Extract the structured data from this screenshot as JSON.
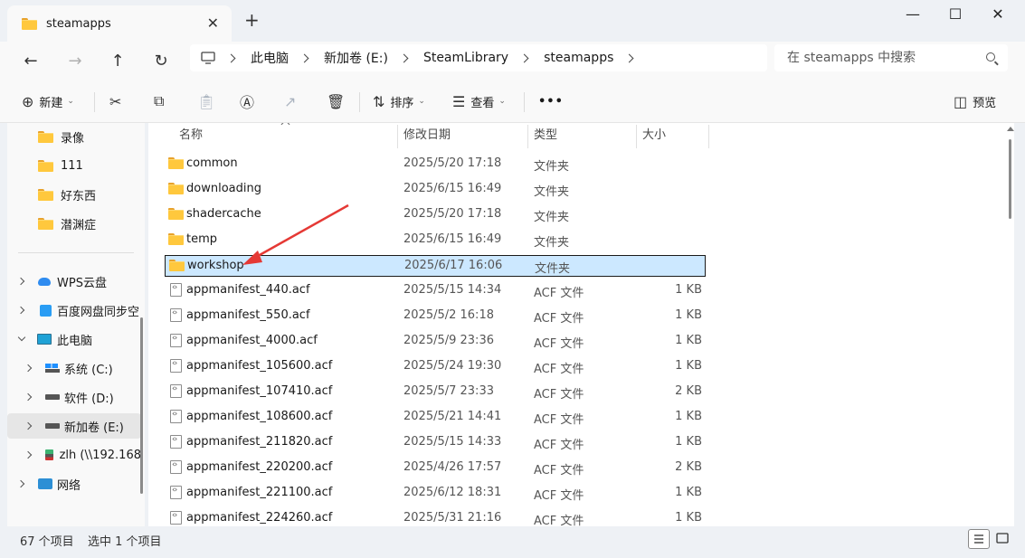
{
  "window": {
    "tab_title": "steamapps",
    "new_tab": "+",
    "close_tab": "✕",
    "minimize": "—",
    "maximize": "☐",
    "close": "✕"
  },
  "nav": {
    "back": "←",
    "forward": "→",
    "up": "↑",
    "refresh": "↻"
  },
  "breadcrumb": [
    "此电脑",
    "新加卷 (E:)",
    "SteamLibrary",
    "steamapps"
  ],
  "search": {
    "placeholder": "在 steamapps 中搜索"
  },
  "commandbar": {
    "new_label": "新建",
    "sort_label": "排序",
    "view_label": "查看",
    "more_label": "•••",
    "preview_label": "预览"
  },
  "sidebar": {
    "quick": [
      "录像",
      "111",
      "好东西",
      "潜渊症"
    ],
    "wps": "WPS云盘",
    "baidu": "百度网盘同步空",
    "thispc": "此电脑",
    "drives": [
      "系统 (C:)",
      "软件 (D:)",
      "新加卷 (E:)",
      "zlh (\\\\192.168"
    ],
    "network": "网络"
  },
  "columns": {
    "name": "名称",
    "date": "修改日期",
    "type": "类型",
    "size": "大小"
  },
  "files": [
    {
      "name": "common",
      "date": "2025/5/20 17:18",
      "type": "文件夹",
      "size": "",
      "kind": "folder"
    },
    {
      "name": "downloading",
      "date": "2025/6/15 16:49",
      "type": "文件夹",
      "size": "",
      "kind": "folder"
    },
    {
      "name": "shadercache",
      "date": "2025/5/20 17:18",
      "type": "文件夹",
      "size": "",
      "kind": "folder"
    },
    {
      "name": "temp",
      "date": "2025/6/15 16:49",
      "type": "文件夹",
      "size": "",
      "kind": "folder"
    },
    {
      "name": "workshop",
      "date": "2025/6/17 16:06",
      "type": "文件夹",
      "size": "",
      "kind": "folder",
      "selected": true
    },
    {
      "name": "appmanifest_440.acf",
      "date": "2025/5/15 14:34",
      "type": "ACF 文件",
      "size": "1 KB",
      "kind": "file"
    },
    {
      "name": "appmanifest_550.acf",
      "date": "2025/5/2 16:18",
      "type": "ACF 文件",
      "size": "1 KB",
      "kind": "file"
    },
    {
      "name": "appmanifest_4000.acf",
      "date": "2025/5/9 23:36",
      "type": "ACF 文件",
      "size": "1 KB",
      "kind": "file"
    },
    {
      "name": "appmanifest_105600.acf",
      "date": "2025/5/24 19:30",
      "type": "ACF 文件",
      "size": "1 KB",
      "kind": "file"
    },
    {
      "name": "appmanifest_107410.acf",
      "date": "2025/5/7 23:33",
      "type": "ACF 文件",
      "size": "2 KB",
      "kind": "file"
    },
    {
      "name": "appmanifest_108600.acf",
      "date": "2025/5/21 14:41",
      "type": "ACF 文件",
      "size": "1 KB",
      "kind": "file"
    },
    {
      "name": "appmanifest_211820.acf",
      "date": "2025/5/15 14:33",
      "type": "ACF 文件",
      "size": "1 KB",
      "kind": "file"
    },
    {
      "name": "appmanifest_220200.acf",
      "date": "2025/4/26 17:57",
      "type": "ACF 文件",
      "size": "2 KB",
      "kind": "file"
    },
    {
      "name": "appmanifest_221100.acf",
      "date": "2025/6/12 18:31",
      "type": "ACF 文件",
      "size": "1 KB",
      "kind": "file"
    },
    {
      "name": "appmanifest_224260.acf",
      "date": "2025/5/31 21:16",
      "type": "ACF 文件",
      "size": "1 KB",
      "kind": "file"
    }
  ],
  "status": {
    "count": "67 个项目",
    "selected": "选中 1 个项目"
  },
  "colors": {
    "selection": "#cce8ff",
    "folder": "#ffc83d",
    "annotation": "#e53935"
  }
}
